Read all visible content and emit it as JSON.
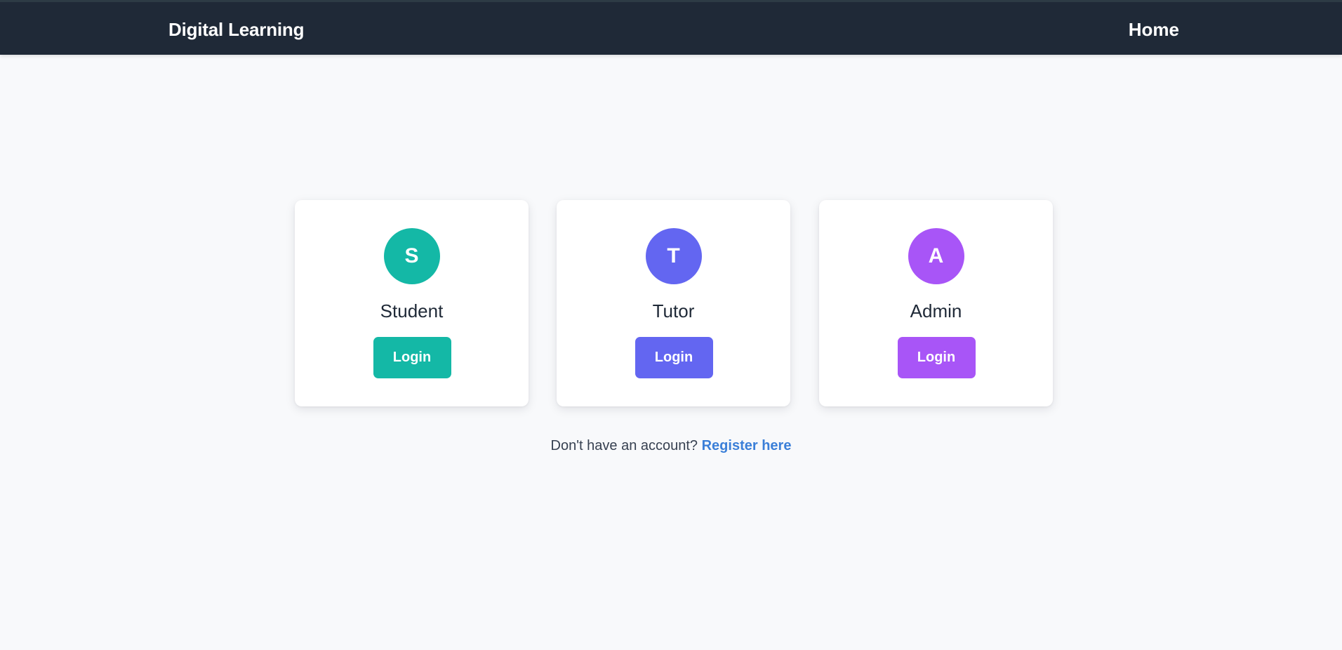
{
  "navbar": {
    "brand": "Digital Learning",
    "home_label": "Home"
  },
  "roles": [
    {
      "initial": "S",
      "title": "Student",
      "button_label": "Login",
      "color": "#14b8a6"
    },
    {
      "initial": "T",
      "title": "Tutor",
      "button_label": "Login",
      "color": "#6366f1"
    },
    {
      "initial": "A",
      "title": "Admin",
      "button_label": "Login",
      "color": "#a855f7"
    }
  ],
  "register": {
    "prompt": "Don't have an account?",
    "link_label": "Register here"
  },
  "colors": {
    "navbar_bg": "#1f2937",
    "page_bg": "#f8f9fb",
    "link": "#3b7fd8"
  }
}
